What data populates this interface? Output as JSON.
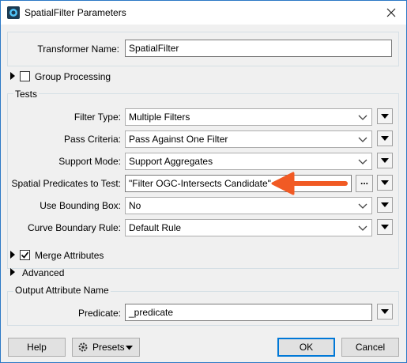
{
  "window": {
    "title": "SpatialFilter Parameters",
    "close_label": "✕"
  },
  "transformer": {
    "label": "Transformer Name:",
    "value": "SpatialFilter"
  },
  "group_processing": {
    "label": "Group Processing",
    "checked": false
  },
  "tests": {
    "title": "Tests",
    "filter_type": {
      "label": "Filter Type:",
      "value": "Multiple Filters"
    },
    "pass_criteria": {
      "label": "Pass Criteria:",
      "value": "Pass Against One Filter"
    },
    "support_mode": {
      "label": "Support Mode:",
      "value": "Support Aggregates"
    },
    "spatial_predicates": {
      "label": "Spatial Predicates to Test:",
      "value": "\"Filter OGC-Intersects Candidate\"",
      "ellipsis": "..."
    },
    "use_bounding_box": {
      "label": "Use Bounding Box:",
      "value": "No"
    },
    "curve_boundary_rule": {
      "label": "Curve Boundary Rule:",
      "value": "Default Rule"
    }
  },
  "merge_attributes": {
    "label": "Merge Attributes",
    "checked": true
  },
  "advanced": {
    "label": "Advanced"
  },
  "output": {
    "title": "Output Attribute Name",
    "predicate": {
      "label": "Predicate:",
      "value": "_predicate"
    }
  },
  "footer": {
    "help": "Help",
    "presets": "Presets",
    "ok": "OK",
    "cancel": "Cancel"
  },
  "colors": {
    "accent": "#2b78c5",
    "arrow": "#f15a24",
    "border": "#d5dfe5"
  }
}
